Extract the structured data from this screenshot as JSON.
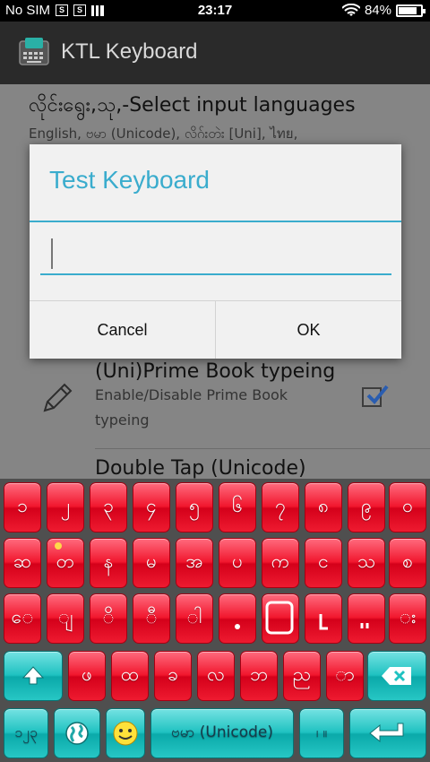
{
  "status_bar": {
    "carrier": "No SIM",
    "sim_icon_label": "S",
    "time": "23:17",
    "battery_percent": "84%",
    "battery_level": 0.84
  },
  "app_bar": {
    "title": "KTL Keyboard"
  },
  "settings": {
    "languages": {
      "title": "လိုင်းရွေး,သု,-Select input languages",
      "summary": "English, ဗမာ (Unicode), လိဂ်းတဲး [Uni], ไทย,"
    },
    "prime_book": {
      "title": "(Uni)Prime Book typeing",
      "summary_line1": "Enable/Disable Prime Book",
      "summary_line2": "typeing",
      "checked": true
    },
    "double_tap": {
      "title": "Double Tap (Unicode)"
    }
  },
  "dialog": {
    "title": "Test Keyboard",
    "input_value": "",
    "cancel_label": "Cancel",
    "ok_label": "OK",
    "accent_color": "#3aaccd"
  },
  "keyboard": {
    "row1": [
      "၁",
      "၂",
      "၃",
      "၄",
      "၅",
      "၆",
      "၇",
      "၈",
      "၉",
      "၀"
    ],
    "row2": [
      "ဆ",
      "တ",
      "န",
      "မ",
      "အ",
      "ပ",
      "က",
      "င",
      "သ",
      "စ"
    ],
    "row3": [
      "ေ",
      "ျ",
      "ိ",
      "ီ",
      "ါ",
      " ",
      " ",
      " ",
      " ",
      "း"
    ],
    "row4": [
      "ဖ",
      "ထ",
      "ခ",
      "လ",
      "ဘ",
      "ည",
      "ာ"
    ],
    "row5": {
      "numbers_label": "၁၂၃",
      "space_label": "ဗမာ (Unicode)",
      "period_label": "၊ ။"
    },
    "key_color": "#f1162d",
    "function_key_color": "#1fc2c1"
  }
}
